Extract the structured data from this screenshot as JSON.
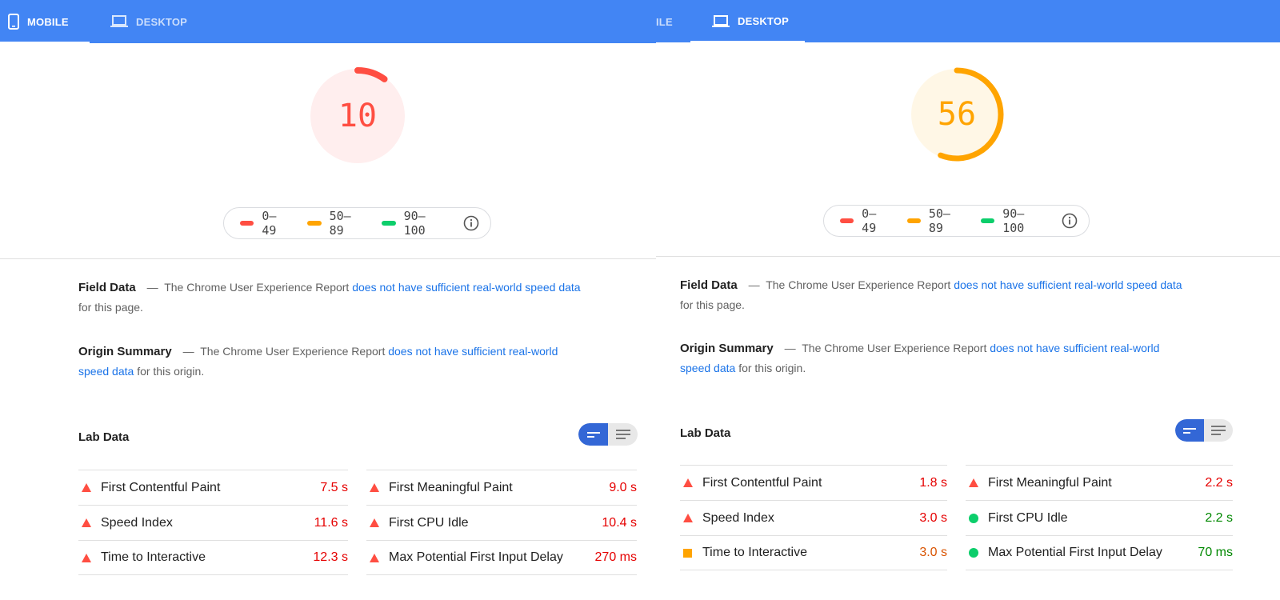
{
  "colors": {
    "fail": "#ff4e42",
    "fail_text": "#e50000",
    "average": "#ffa400",
    "average_text": "#d95300",
    "pass": "#0cce6b",
    "pass_text": "#008800",
    "brand_blue": "#4285f4",
    "link": "#1a73e8"
  },
  "left": {
    "tabs": {
      "mobile": "MOBILE",
      "desktop": "DESKTOP"
    },
    "score": {
      "value": "10",
      "fraction": 0.1,
      "rating": "fail"
    },
    "legend": {
      "fail": "0–49",
      "average": "50–89",
      "pass": "90–100"
    },
    "field_data": {
      "heading": "Field Data",
      "dash": "—",
      "text_before": "The Chrome User Experience Report",
      "link": "does not have sufficient real-world speed data",
      "text_after": "for this page."
    },
    "origin_summary": {
      "heading": "Origin Summary",
      "dash": "—",
      "text_before": "The Chrome User Experience Report",
      "link": "does not have sufficient real-world speed data",
      "text_after": "for this origin."
    },
    "lab_data": {
      "title": "Lab Data"
    },
    "metrics_col1": [
      {
        "name": "First Contentful Paint",
        "value": "7.5 s",
        "rating": "fail"
      },
      {
        "name": "Speed Index",
        "value": "11.6 s",
        "rating": "fail"
      },
      {
        "name": "Time to Interactive",
        "value": "12.3 s",
        "rating": "fail"
      }
    ],
    "metrics_col2": [
      {
        "name": "First Meaningful Paint",
        "value": "9.0 s",
        "rating": "fail"
      },
      {
        "name": "First CPU Idle",
        "value": "10.4 s",
        "rating": "fail"
      },
      {
        "name": "Max Potential First Input Delay",
        "value": "270 ms",
        "rating": "fail"
      }
    ]
  },
  "right": {
    "tabs": {
      "mobile": "ILE",
      "desktop": "DESKTOP"
    },
    "score": {
      "value": "56",
      "fraction": 0.56,
      "rating": "average"
    },
    "legend": {
      "fail": "0–49",
      "average": "50–89",
      "pass": "90–100"
    },
    "field_data": {
      "heading": "Field Data",
      "dash": "—",
      "text_before": "The Chrome User Experience Report",
      "link": "does not have sufficient real-world speed data",
      "text_after": "for this page."
    },
    "origin_summary": {
      "heading": "Origin Summary",
      "dash": "—",
      "text_before": "The Chrome User Experience Report",
      "link": "does not have sufficient real-world speed data",
      "text_after": "for this origin."
    },
    "lab_data": {
      "title": "Lab Data"
    },
    "metrics_col1": [
      {
        "name": "First Contentful Paint",
        "value": "1.8 s",
        "rating": "fail"
      },
      {
        "name": "Speed Index",
        "value": "3.0 s",
        "rating": "fail"
      },
      {
        "name": "Time to Interactive",
        "value": "3.0 s",
        "rating": "average"
      }
    ],
    "metrics_col2": [
      {
        "name": "First Meaningful Paint",
        "value": "2.2 s",
        "rating": "fail"
      },
      {
        "name": "First CPU Idle",
        "value": "2.2 s",
        "rating": "pass"
      },
      {
        "name": "Max Potential First Input Delay",
        "value": "70 ms",
        "rating": "pass"
      }
    ]
  }
}
